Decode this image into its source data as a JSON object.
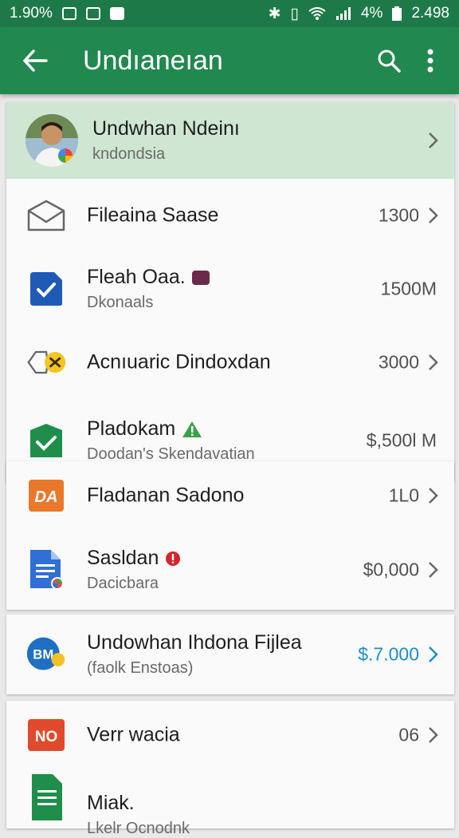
{
  "status_bar": {
    "left_text": "1.90%",
    "right_text": "2.498",
    "signal_text": "4%",
    "icons": [
      "messenger-icon",
      "voicemail-icon",
      "photo-icon",
      "bluetooth-icon",
      "vibrate-icon",
      "wifi-icon",
      "signal-icon",
      "battery-icon"
    ]
  },
  "app_bar": {
    "title": "Undıaneıan",
    "back_icon": "arrow-back-icon",
    "search_icon": "search-icon",
    "menu_icon": "more-vert-icon",
    "color": "#21884f"
  },
  "profile": {
    "name": "Undwhan Ndeinı",
    "subtitle": "kndondsia",
    "highlight_color": "#cfe6d3"
  },
  "group1": [
    {
      "title": "Fileaina Saase",
      "subtitle": "",
      "value": "1300",
      "arrow": true,
      "icon": "envelope-icon"
    },
    {
      "title": "Fleah Oaa.",
      "subtitle": "Dkonaals",
      "value": "1500M",
      "arrow": false,
      "icon": "task-check-icon"
    },
    {
      "title": "Acnıuaric Dindoxdan",
      "subtitle": "",
      "value": "3000",
      "arrow": true,
      "icon": "settings-face-icon"
    },
    {
      "title": "Pladokam",
      "subtitle": "Doodan's Skendavatian",
      "value": "$,500l M",
      "arrow": false,
      "icon": "green-check-icon"
    }
  ],
  "group2": [
    {
      "title": "Fladanan Sadono",
      "subtitle": "",
      "value": "1L0",
      "arrow": true,
      "icon": "da-icon"
    },
    {
      "title": "Sasldan",
      "subtitle": "Dacicbara",
      "value": "$0,000",
      "arrow": true,
      "icon": "docs-icon"
    }
  ],
  "group3": [
    {
      "title": "Undowhan Ihdona Fijlea",
      "subtitle": "(faolk Enstoas)",
      "value": "$.7.000",
      "arrow": true,
      "icon": "bm-icon",
      "value_color": "#1a8fc8"
    }
  ],
  "group4": [
    {
      "title": "Verr wacia",
      "subtitle": "",
      "value": "06",
      "arrow": true,
      "icon": "no-icon"
    },
    {
      "title": "Miak.",
      "subtitle": "Lkelr Ocnodnk",
      "value": "",
      "arrow": false,
      "icon": "sheets-icon"
    }
  ]
}
